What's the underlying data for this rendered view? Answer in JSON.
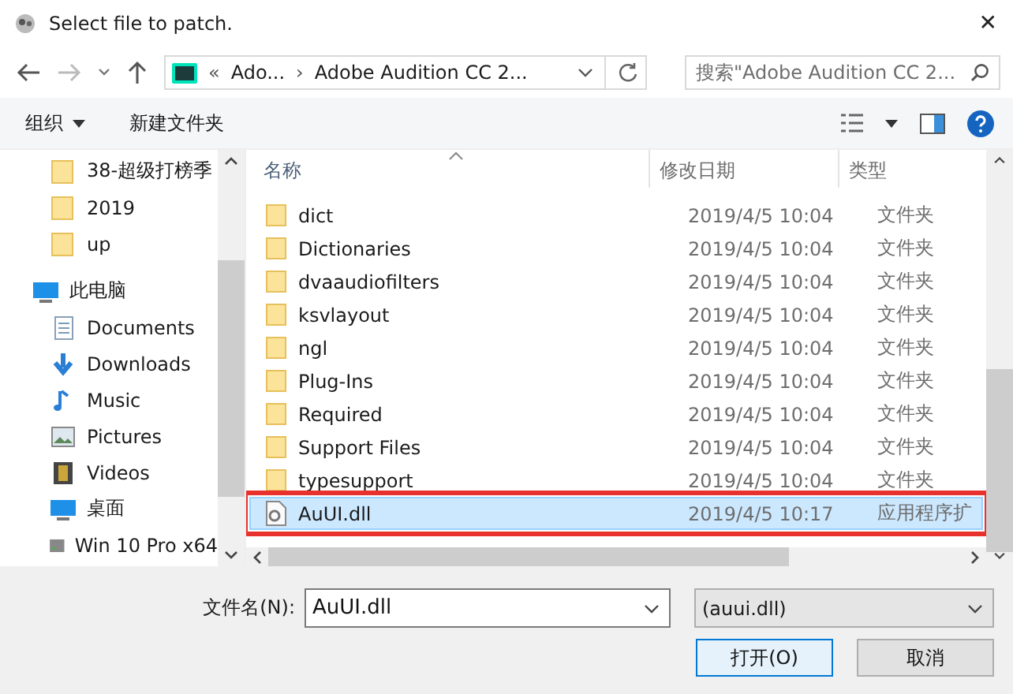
{
  "window": {
    "title": "Select file to patch.",
    "close": "✕"
  },
  "address": {
    "overflow": "«",
    "separator": "›",
    "crumbs": [
      "Ado...",
      "Adobe Audition CC 2..."
    ]
  },
  "search": {
    "placeholder": "搜索\"Adobe Audition CC 2..."
  },
  "toolbar": {
    "organize": "组织",
    "new_folder": "新建文件夹"
  },
  "nav": [
    {
      "label": "38-超级打榜季",
      "kind": "folder"
    },
    {
      "label": "2019",
      "kind": "folder"
    },
    {
      "label": "up",
      "kind": "folder"
    },
    {
      "label": "此电脑",
      "kind": "pc",
      "children": [
        {
          "label": "Documents",
          "kind": "documents"
        },
        {
          "label": "Downloads",
          "kind": "downloads"
        },
        {
          "label": "Music",
          "kind": "music"
        },
        {
          "label": "Pictures",
          "kind": "pictures"
        },
        {
          "label": "Videos",
          "kind": "videos"
        },
        {
          "label": "桌面",
          "kind": "desktop"
        },
        {
          "label": "Win 10 Pro x64",
          "kind": "drive"
        }
      ]
    }
  ],
  "columns": [
    "名称",
    "修改日期",
    "类型"
  ],
  "rows": [
    {
      "name": "dict",
      "date": "2019/4/5 10:04",
      "type": "文件夹",
      "kind": "folder",
      "selected": false,
      "highlighted": false
    },
    {
      "name": "Dictionaries",
      "date": "2019/4/5 10:04",
      "type": "文件夹",
      "kind": "folder",
      "selected": false,
      "highlighted": false
    },
    {
      "name": "dvaaudiofilters",
      "date": "2019/4/5 10:04",
      "type": "文件夹",
      "kind": "folder",
      "selected": false,
      "highlighted": false
    },
    {
      "name": "ksvlayout",
      "date": "2019/4/5 10:04",
      "type": "文件夹",
      "kind": "folder",
      "selected": false,
      "highlighted": false
    },
    {
      "name": "ngl",
      "date": "2019/4/5 10:04",
      "type": "文件夹",
      "kind": "folder",
      "selected": false,
      "highlighted": false
    },
    {
      "name": "Plug-Ins",
      "date": "2019/4/5 10:04",
      "type": "文件夹",
      "kind": "folder",
      "selected": false,
      "highlighted": false
    },
    {
      "name": "Required",
      "date": "2019/4/5 10:04",
      "type": "文件夹",
      "kind": "folder",
      "selected": false,
      "highlighted": false
    },
    {
      "name": "Support Files",
      "date": "2019/4/5 10:04",
      "type": "文件夹",
      "kind": "folder",
      "selected": false,
      "highlighted": false
    },
    {
      "name": "typesupport",
      "date": "2019/4/5 10:04",
      "type": "文件夹",
      "kind": "folder",
      "selected": false,
      "highlighted": false
    },
    {
      "name": "AuUI.dll",
      "date": "2019/4/5 10:17",
      "type": "应用程序扩",
      "kind": "file",
      "selected": true,
      "highlighted": true
    }
  ],
  "filename": {
    "label": "文件名(N):",
    "value": "AuUI.dll"
  },
  "filter": {
    "value": "(auui.dll)"
  },
  "buttons": [
    "打开(O)",
    "取消"
  ]
}
